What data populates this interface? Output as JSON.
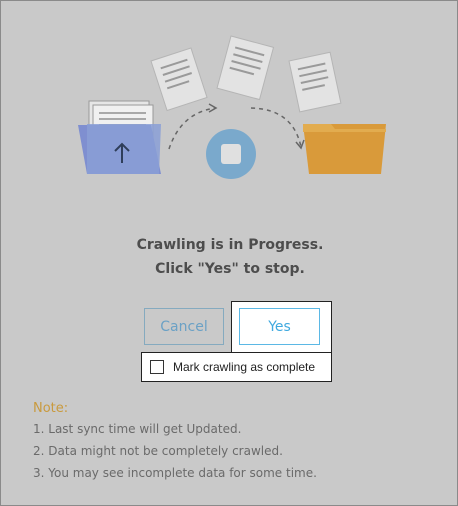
{
  "dialog": {
    "message_line1": "Crawling is in Progress.",
    "message_line2": "Click \"Yes\" to stop."
  },
  "buttons": {
    "cancel_label": "Cancel",
    "yes_label": "Yes"
  },
  "checkbox": {
    "label": "Mark crawling as complete",
    "checked": false
  },
  "notes": {
    "title": "Note:",
    "items": [
      "1. Last sync time will get Updated.",
      "2. Data might not be completely crawled.",
      "3. You may see incomplete data for some time."
    ]
  },
  "colors": {
    "overlay": "#c9c9c9",
    "accent": "#3fa9df",
    "note_title": "#c99a3e",
    "source_folder": "#7f8fd0",
    "target_folder": "#d99a3a",
    "stop_button": "#7aa9cc"
  },
  "icons": [
    "source-folder-icon",
    "upload-arrow-icon",
    "stop-icon",
    "target-folder-icon",
    "paper-sheet-icon"
  ]
}
